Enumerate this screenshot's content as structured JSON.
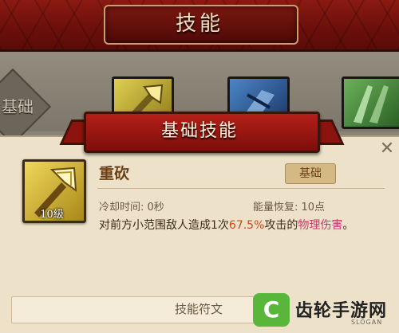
{
  "header": {
    "title": "技能"
  },
  "tabs": {
    "left_label": "基础",
    "icons": [
      {
        "name": "gold-skill-tab-icon",
        "color": "#e0cf52"
      },
      {
        "name": "blue-skill-tab-icon",
        "color": "#4a86c7"
      },
      {
        "name": "green-skill-tab-icon",
        "color": "#6ab25a"
      }
    ]
  },
  "dialog": {
    "title": "基础技能",
    "close_icon": "close-icon"
  },
  "skill": {
    "icon": "axe-icon",
    "level": "10級",
    "name": "重砍",
    "type": "基础",
    "cooldown": "冷却时间: 0秒",
    "energy": "能量恢复: 10点",
    "desc": {
      "part1": "对前方小范围敌人造成",
      "count": "1次",
      "percent": "67.5%",
      "part2": "攻击的",
      "phys": "物理伤害",
      "end": "。"
    }
  },
  "rune": {
    "label": "技能符文"
  },
  "watermark": {
    "logo_letter": "C",
    "text": "齿轮手游网",
    "slogan": "SLOGAN"
  },
  "colors": {
    "header_red": "#8a1a12",
    "panel_bg": "#ede2c9",
    "highlight_orange": "#c8471b",
    "highlight_phys": "#c43a6b",
    "watermark_green": "#58b63a"
  }
}
